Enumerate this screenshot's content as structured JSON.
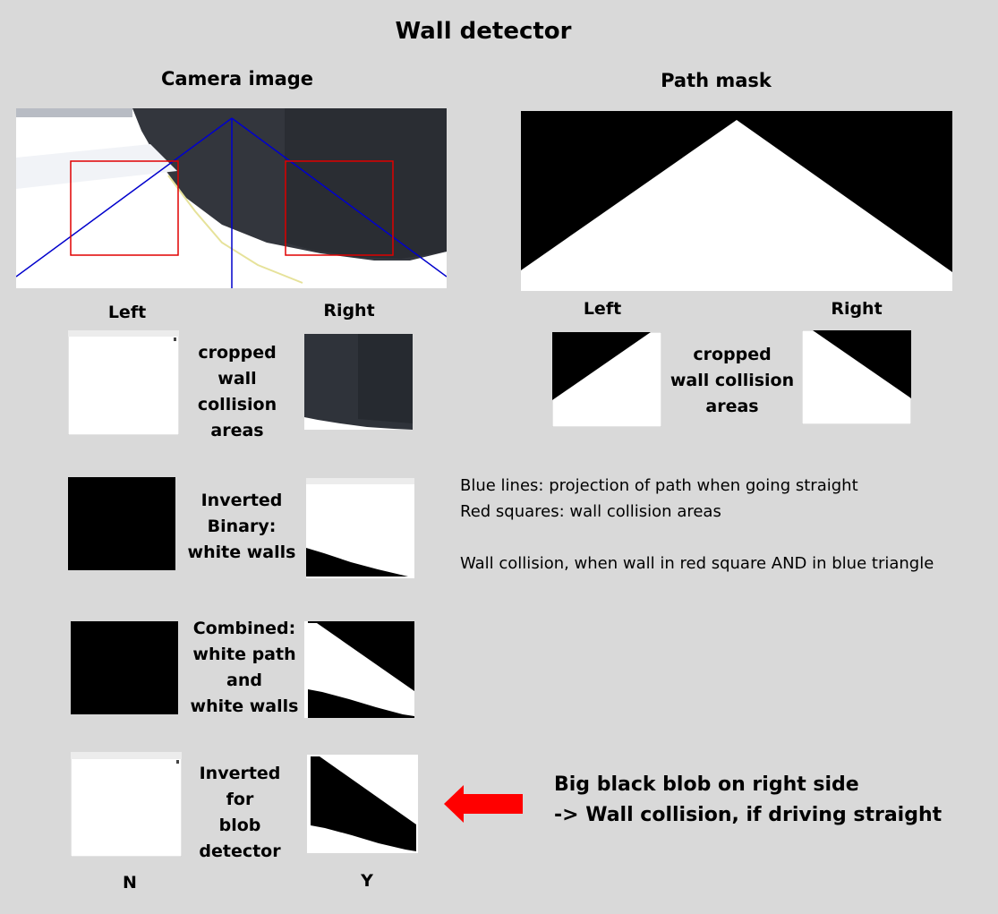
{
  "title": "Wall detector",
  "camera": {
    "heading": "Camera image"
  },
  "mask": {
    "heading": "Path mask"
  },
  "labels": {
    "left": "Left",
    "right": "Right"
  },
  "rows": {
    "cropped": "cropped\nwall collision\nareas",
    "inverted_binary": "Inverted\nBinary:\nwhite walls",
    "combined": "Combined:\nwhite path\nand\nwhite walls",
    "inverted_blob": "Inverted\nfor\nblob detector"
  },
  "legend": {
    "blue": "Blue lines: projection of path when going straight",
    "red": "Red squares: wall collision areas",
    "rule": "Wall collision, when wall in red square AND in blue triangle"
  },
  "result": {
    "line1": "Big black blob on right side",
    "line2": "-> Wall collision, if driving straight",
    "left_result": "N",
    "right_result": "Y"
  },
  "colors": {
    "background": "#d9d9d9",
    "blue_lines": "#0000cc",
    "red_squares": "#e00000",
    "arrow": "#ff0000"
  }
}
